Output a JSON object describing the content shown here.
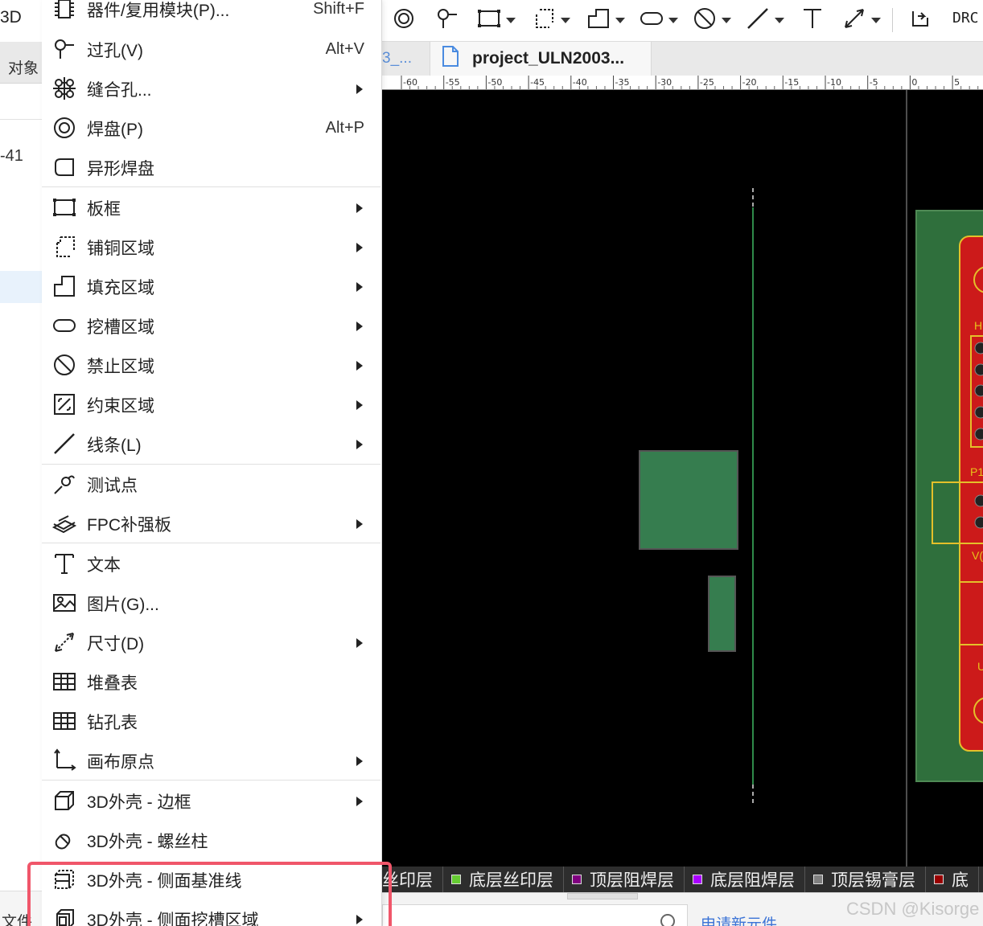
{
  "left_panel": {
    "partial_3d": "3D",
    "partial_tab": "对象",
    "partial_number": "-41",
    "partial_bottom": "文件"
  },
  "toolbar": {
    "drc_label": "DRC",
    "icons": [
      "pad-icon",
      "via-icon",
      "board-frame-icon",
      "copper-area-icon",
      "fill-region-icon",
      "slot-region-icon",
      "keepout-icon",
      "line-icon",
      "text-icon",
      "dimension-icon",
      "import-icon"
    ]
  },
  "tabs": {
    "prev_tab_fragment": "3_...",
    "active_tab": "project_ULN2003..."
  },
  "ruler": {
    "ticks": [
      "-60",
      "-55",
      "-50",
      "-45",
      "-40",
      "-35",
      "-30",
      "-25",
      "-20",
      "-15",
      "-10",
      "-5",
      "0",
      "5"
    ]
  },
  "menu": {
    "items": [
      {
        "label": "器件/复用模块(P)...",
        "shortcut": "Shift+F",
        "icon": "component-icon"
      },
      {
        "label": "过孔(V)",
        "shortcut": "Alt+V",
        "icon": "via-icon"
      },
      {
        "label": "缝合孔...",
        "shortcut": "",
        "icon": "stitching-via-icon",
        "submenu": true
      },
      {
        "label": "焊盘(P)",
        "shortcut": "Alt+P",
        "icon": "pad-icon"
      },
      {
        "label": "异形焊盘",
        "shortcut": "",
        "icon": "custom-pad-icon"
      },
      {
        "label": "板框",
        "shortcut": "",
        "icon": "board-frame-icon",
        "submenu": true
      },
      {
        "label": "铺铜区域",
        "shortcut": "",
        "icon": "copper-area-icon",
        "submenu": true
      },
      {
        "label": "填充区域",
        "shortcut": "",
        "icon": "fill-region-icon",
        "submenu": true
      },
      {
        "label": "挖槽区域",
        "shortcut": "",
        "icon": "slot-region-icon",
        "submenu": true
      },
      {
        "label": "禁止区域",
        "shortcut": "",
        "icon": "keepout-icon",
        "submenu": true
      },
      {
        "label": "约束区域",
        "shortcut": "",
        "icon": "constraint-region-icon",
        "submenu": true
      },
      {
        "label": "线条(L)",
        "shortcut": "",
        "icon": "line-icon",
        "submenu": true
      },
      {
        "label": "测试点",
        "shortcut": "",
        "icon": "test-point-icon"
      },
      {
        "label": "FPC补强板",
        "shortcut": "",
        "icon": "fpc-stiffener-icon",
        "submenu": true
      },
      {
        "label": "文本",
        "shortcut": "",
        "icon": "text-icon"
      },
      {
        "label": "图片(G)...",
        "shortcut": "",
        "icon": "image-icon"
      },
      {
        "label": "尺寸(D)",
        "shortcut": "",
        "icon": "dimension-icon",
        "submenu": true
      },
      {
        "label": "堆叠表",
        "shortcut": "",
        "icon": "stackup-table-icon"
      },
      {
        "label": "钻孔表",
        "shortcut": "",
        "icon": "drill-table-icon"
      },
      {
        "label": "画布原点",
        "shortcut": "",
        "icon": "canvas-origin-icon",
        "submenu": true
      },
      {
        "label": "3D外壳 - 边框",
        "shortcut": "",
        "icon": "enclosure-frame-icon",
        "submenu": true
      },
      {
        "label": "3D外壳 - 螺丝柱",
        "shortcut": "",
        "icon": "screw-post-icon"
      },
      {
        "label": "3D外壳 - 侧面基准线",
        "shortcut": "",
        "icon": "side-datum-line-icon"
      },
      {
        "label": "3D外壳 - 侧面挖槽区域",
        "shortcut": "",
        "icon": "side-slot-region-icon",
        "submenu": true
      }
    ]
  },
  "layers": [
    {
      "label": "丝印层",
      "color": "#ffcc00",
      "partial": true
    },
    {
      "label": "底层丝印层",
      "color": "#66cc33"
    },
    {
      "label": "顶层阻焊层",
      "color": "#800080"
    },
    {
      "label": "底层阻焊层",
      "color": "#aa00ff"
    },
    {
      "label": "顶层锡膏层",
      "color": "#808080"
    },
    {
      "label": "底",
      "color": "#990000",
      "partial": true
    }
  ],
  "canvas_labels": {
    "h": "H",
    "p": "P1",
    "v": "V(",
    "u": "U"
  },
  "bottom": {
    "link": "申请新元件",
    "watermark": "CSDN @Kisorge"
  },
  "colors": {
    "accent": "#3b73d6",
    "highlight": "#f0566a",
    "pcb_green": "#2f7d4a",
    "pcb_red": "#cc1a1a",
    "silk_yellow": "#e8c21a"
  }
}
